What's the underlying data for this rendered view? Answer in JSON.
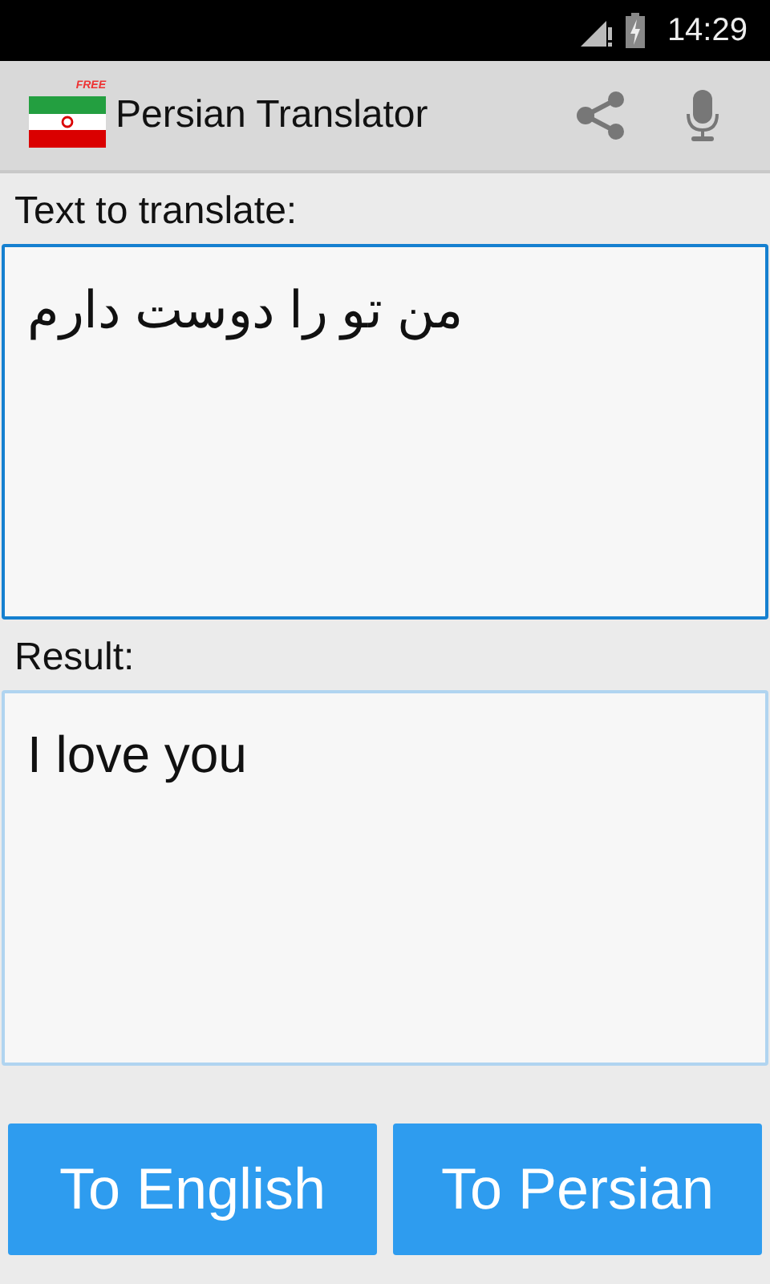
{
  "status_bar": {
    "time": "14:29"
  },
  "app_bar": {
    "title": "Persian Translator",
    "flag_badge": "FREE"
  },
  "input": {
    "label": "Text to translate:",
    "value": "من تو را دوست دارم",
    "focused": true
  },
  "result": {
    "label": "Result:",
    "value": "I love you",
    "focused": false
  },
  "buttons": [
    "To English",
    "To Persian"
  ]
}
